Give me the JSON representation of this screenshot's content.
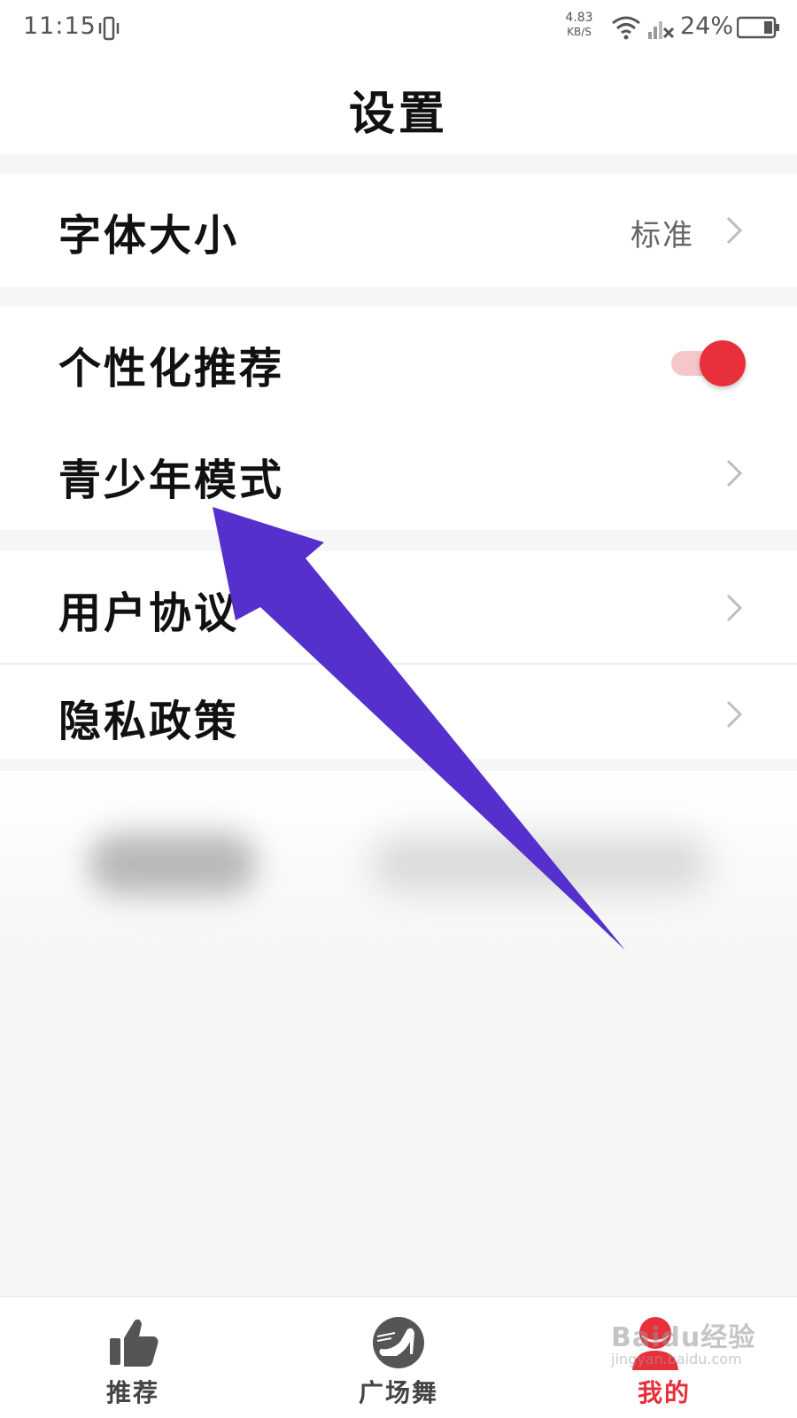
{
  "status_bar": {
    "time": "11:15",
    "net_speed_value": "4.83",
    "net_speed_unit": "KB/S",
    "battery": "24%",
    "icons": [
      "vibrate-icon",
      "wifi-icon",
      "signal-icon",
      "battery-icon"
    ]
  },
  "header": {
    "title": "设置"
  },
  "settings": {
    "font_size": {
      "label": "字体大小",
      "value": "标准"
    },
    "personalized": {
      "label": "个性化推荐",
      "enabled": true
    },
    "teen_mode": {
      "label": "青少年模式"
    },
    "user_agreement": {
      "label": "用户协议"
    },
    "privacy_policy": {
      "label": "隐私政策"
    }
  },
  "bottom_nav": {
    "items": [
      {
        "label": "推荐",
        "icon": "thumbs-up-icon",
        "active": false
      },
      {
        "label": "广场舞",
        "icon": "high-heel-icon",
        "active": false
      },
      {
        "label": "我的",
        "icon": "user-avatar-icon",
        "active": true
      }
    ]
  },
  "watermark": {
    "text": "Baidu经验",
    "sub": "jingyan.baidu.com"
  },
  "colors": {
    "accent": "#e8303a",
    "toggle_track": "#f6c7c9",
    "arrow": "#5530cc",
    "background": "#f6f6f6"
  }
}
